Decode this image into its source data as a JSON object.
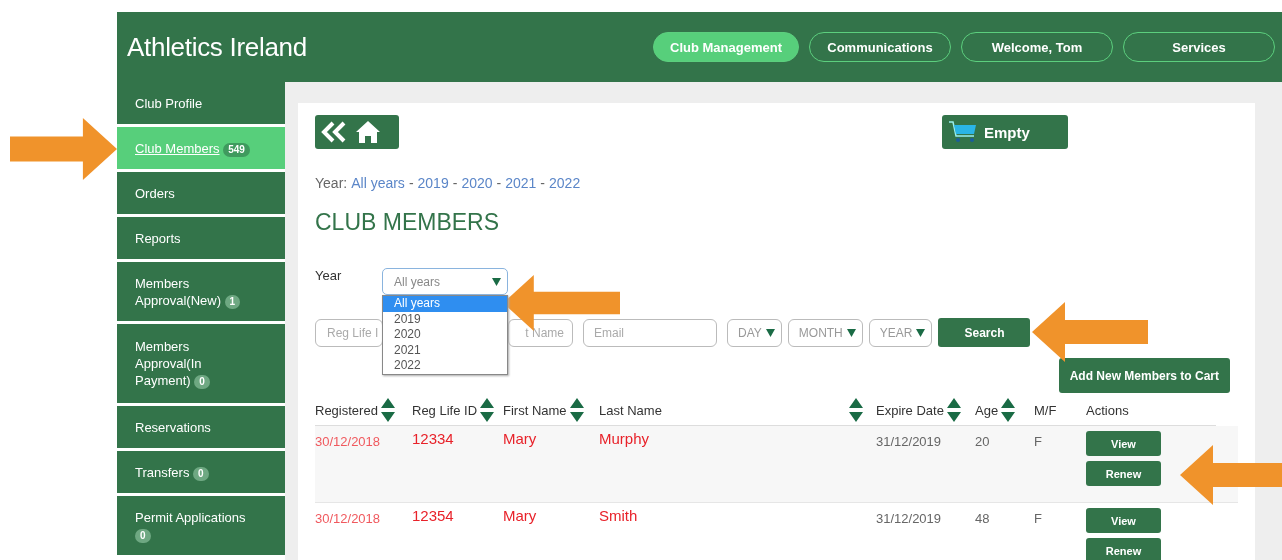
{
  "header": {
    "title": "Athletics Ireland",
    "nav": [
      {
        "label": "Club Management",
        "selected": true
      },
      {
        "label": "Communications",
        "selected": false
      },
      {
        "label": "Welcome, Tom",
        "selected": false
      },
      {
        "label": "Services",
        "selected": false
      }
    ]
  },
  "sidebar": {
    "items": [
      {
        "label": "Club Profile",
        "selected": false
      },
      {
        "label": "Club Members",
        "badge": "549",
        "selected": true
      },
      {
        "label": "Orders",
        "selected": false
      },
      {
        "label": "Reports",
        "selected": false
      },
      {
        "label": "Members Approval(New)",
        "badge": "1",
        "selected": false
      },
      {
        "label": "Members Approval(In Payment)",
        "badge": "0",
        "selected": false
      },
      {
        "label": "Reservations",
        "selected": false
      },
      {
        "label": "Transfers",
        "badge": "0",
        "selected": false
      },
      {
        "label": "Permit Applications",
        "badge": "0",
        "selected": false
      }
    ]
  },
  "cart": {
    "label": "Empty"
  },
  "year_links": {
    "label": "Year:",
    "separator": "-",
    "links": [
      "All years",
      "2019",
      "2020",
      "2021",
      "2022"
    ]
  },
  "heading": "CLUB MEMBERS",
  "filters": {
    "year_label": "Year",
    "year_select": {
      "value": "All years",
      "expanded": true,
      "options": [
        {
          "label": "All years",
          "selected": true
        },
        {
          "label": "2019",
          "selected": false
        },
        {
          "label": "2020",
          "selected": false
        },
        {
          "label": "2021",
          "selected": false
        },
        {
          "label": "2022",
          "selected": false
        }
      ]
    },
    "fields": [
      {
        "placeholder": "Reg Life I"
      },
      {
        "placeholder": "t Name"
      },
      {
        "placeholder": "Email"
      }
    ],
    "date_selects": [
      "DAY",
      "MONTH",
      "YEAR"
    ],
    "search_button": "Search"
  },
  "add_button": "Add New Members to Cart",
  "table": {
    "columns": [
      {
        "label": "Registered",
        "sortable": true
      },
      {
        "label": "Reg Life ID",
        "sortable": true
      },
      {
        "label": "First Name",
        "sortable": true
      },
      {
        "label": "Last Name",
        "sortable": false
      },
      {
        "sortable": true
      },
      {
        "label": "Expire Date",
        "sortable": true
      },
      {
        "label": "Age",
        "sortable": true
      },
      {
        "label": "M/F",
        "sortable": false
      },
      {
        "label": "Actions",
        "sortable": false
      }
    ],
    "rows": [
      {
        "registered": "30/12/2018",
        "reg_life_id": "12334",
        "first_name": "Mary",
        "last_name": "Murphy",
        "expire_date": "31/12/2019",
        "age": "20",
        "sex": "F",
        "actions": [
          "View",
          "Renew"
        ]
      },
      {
        "registered": "30/12/2018",
        "reg_life_id": "12354",
        "first_name": "Mary",
        "last_name": "Smith",
        "expire_date": "31/12/2019",
        "age": "48",
        "sex": "F",
        "actions": [
          "View",
          "Renew"
        ]
      }
    ]
  }
}
